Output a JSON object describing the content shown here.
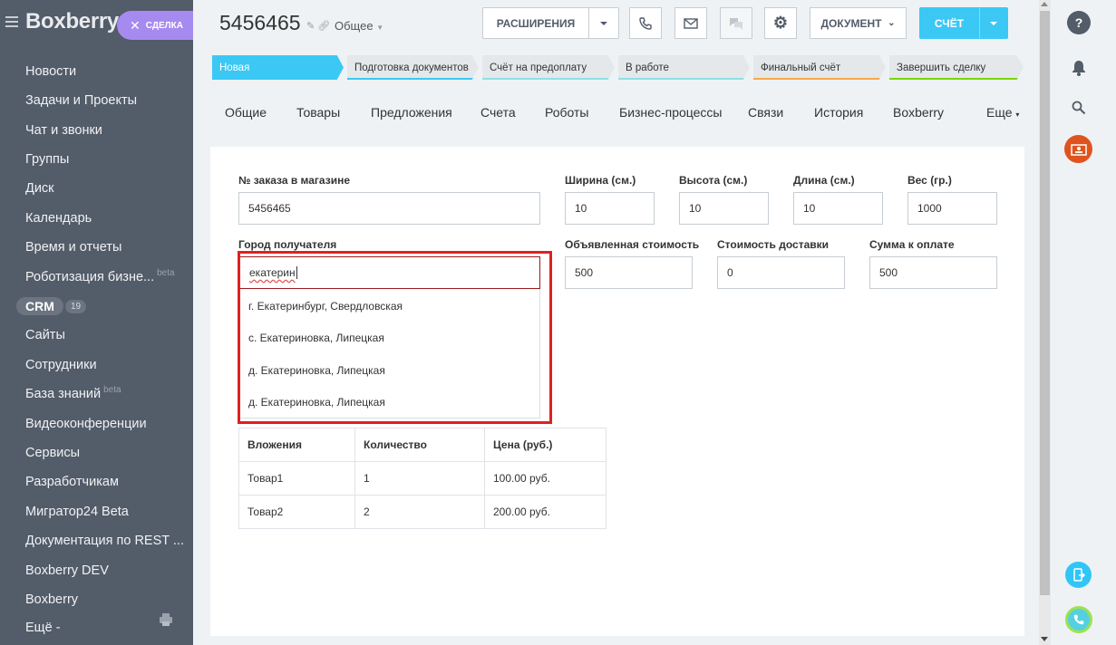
{
  "sidebar": {
    "logo": "Boxberry",
    "deal_button": "СДЕЛКА",
    "items": [
      {
        "label": "Новости"
      },
      {
        "label": "Задачи и Проекты"
      },
      {
        "label": "Чат и звонки"
      },
      {
        "label": "Группы"
      },
      {
        "label": "Диск"
      },
      {
        "label": "Календарь"
      },
      {
        "label": "Время и отчеты"
      },
      {
        "label": "Роботизация бизне..."
      },
      {
        "label": "CRM"
      },
      {
        "label": "Сайты"
      },
      {
        "label": "Сотрудники"
      },
      {
        "label": "База знаний"
      },
      {
        "label": "Видеоконференции"
      },
      {
        "label": "Сервисы"
      },
      {
        "label": "Разработчикам"
      },
      {
        "label": "Мигратор24 Beta"
      },
      {
        "label": "Документация по REST ..."
      },
      {
        "label": "Boxberry DEV"
      },
      {
        "label": "Boxberry"
      },
      {
        "label": "Ещё -"
      }
    ],
    "beta_label": "beta",
    "crm_count": "19"
  },
  "header": {
    "deal_id": "5456465",
    "deal_type": "Общее",
    "extensions_label": "РАСШИРЕНИЯ",
    "document_label": "ДОКУМЕНТ",
    "invoice_label": "СЧЁТ"
  },
  "stages": [
    {
      "label": "Новая",
      "color": "#3bc8f5"
    },
    {
      "label": "Подготовка документов",
      "color": "#3bc8f5"
    },
    {
      "label": "Счёт на предоплату",
      "color": "#8ee1e4"
    },
    {
      "label": "В работе",
      "color": "#8ee1e4"
    },
    {
      "label": "Финальный счёт",
      "color": "#f6a84b"
    },
    {
      "label": "Завершить сделку",
      "color": "#7bd500"
    }
  ],
  "tabs": [
    {
      "label": "Общие"
    },
    {
      "label": "Товары"
    },
    {
      "label": "Предложения"
    },
    {
      "label": "Счета"
    },
    {
      "label": "Роботы"
    },
    {
      "label": "Бизнес-процессы"
    },
    {
      "label": "Связи"
    },
    {
      "label": "История"
    },
    {
      "label": "Boxberry"
    },
    {
      "label": "Еще"
    }
  ],
  "form": {
    "order_label": "№ заказа в магазине",
    "order_value": "5456465",
    "width_label": "Ширина (см.)",
    "width_value": "10",
    "height_label": "Высота (см.)",
    "height_value": "10",
    "length_label": "Длина (см.)",
    "length_value": "10",
    "weight_label": "Вес (гр.)",
    "weight_value": "1000",
    "city_label": "Город получателя",
    "city_value": "екатерин",
    "declared_label": "Объявленная стоимость",
    "declared_value": "500",
    "delivery_label": "Стоимость доставки",
    "delivery_value": "0",
    "total_label": "Сумма к оплате",
    "total_value": "500"
  },
  "city_suggestions": [
    {
      "label": "г. Екатеринбург, Свердловская"
    },
    {
      "label": "с. Екатериновка, Липецкая"
    },
    {
      "label": "д. Екатериновка, Липецкая"
    },
    {
      "label": "д. Екатериновка, Липецкая"
    }
  ],
  "attachments_table": {
    "headers": [
      "Вложения",
      "Количество",
      "Цена (руб.)"
    ],
    "rows": [
      [
        "Товар1",
        "1",
        "100.00 руб."
      ],
      [
        "Товар2",
        "2",
        "200.00 руб."
      ]
    ]
  },
  "colors": {
    "sidebar_bg": "#535c69",
    "accent": "#3bc8f5",
    "deal_badge": "#a68af0",
    "highlight": "#e0201f"
  },
  "icons": {
    "right_panel": [
      "help-icon",
      "bell-icon",
      "search-icon",
      "crm-icon",
      "transfer-icon",
      "phone-icon"
    ]
  }
}
